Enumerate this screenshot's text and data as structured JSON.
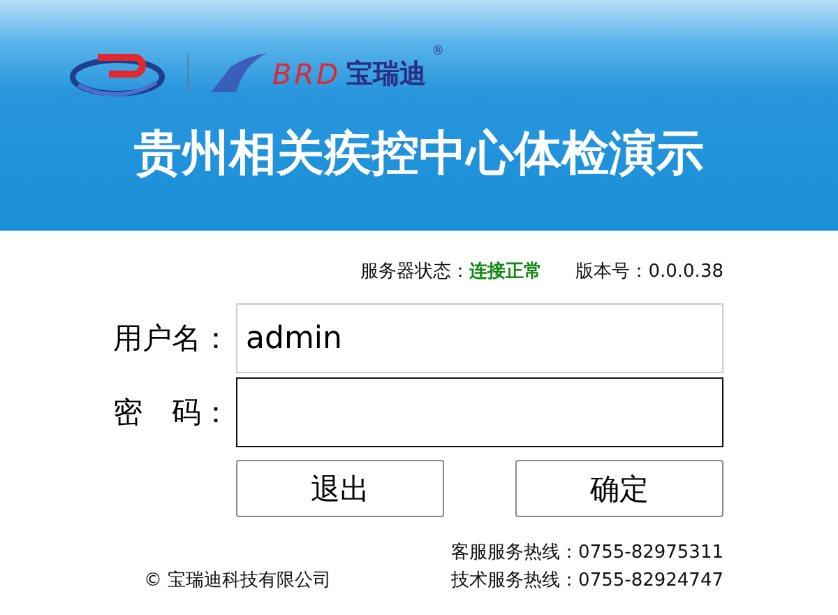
{
  "header": {
    "brand_text": "BRD",
    "brand_name": "宝瑞迪",
    "registered_mark": "®",
    "title": "贵州相关疾控中心体检演示"
  },
  "status": {
    "server_label": "服务器状态：",
    "server_value": "连接正常",
    "version_label": "版本号：0.0.0.38"
  },
  "fields": [
    {
      "label": "用户名：",
      "value": "admin",
      "kind": "text",
      "focused": false
    },
    {
      "label": "密　码：",
      "kind": "password",
      "focused": true
    }
  ],
  "buttons": [
    {
      "label": "退出"
    },
    {
      "label": "确定"
    }
  ],
  "footer": {
    "copyright": "© 宝瑞迪科技有限公司",
    "hotlines": [
      "客服服务热线：0755-82975311",
      "技术服务热线：0755-82924747"
    ]
  }
}
